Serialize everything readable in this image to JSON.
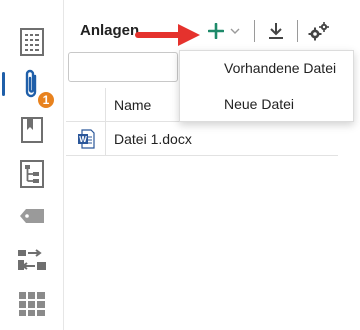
{
  "rail": {
    "items": [
      {
        "name": "document-grid-icon"
      },
      {
        "name": "paperclip-icon",
        "active": true,
        "badge": "1"
      },
      {
        "name": "bookmark-icon"
      },
      {
        "name": "hierarchy-icon"
      },
      {
        "name": "tag-icon"
      },
      {
        "name": "transfer-icon"
      },
      {
        "name": "tiles-icon"
      }
    ]
  },
  "panel": {
    "title": "Anlagen",
    "toolbar": {
      "add_icon": "plus-icon",
      "add_dropdown_icon": "chevron-down-icon",
      "download_icon": "download-icon",
      "settings_icon": "gears-icon"
    },
    "table": {
      "columns": [
        "Name"
      ],
      "rows": [
        {
          "icon": "word-document-icon",
          "name": "Datei 1.docx"
        }
      ]
    }
  },
  "dropdown": {
    "items": [
      "Vorhandene Datei",
      "Neue Datei"
    ]
  },
  "colors": {
    "accent_green": "#1e8a6a",
    "badge_orange": "#e8821e",
    "annotation_red": "#e5322d",
    "rail_icon_gray": "#6f6f6f",
    "active_blue": "#1f5fa9",
    "word_blue": "#2b579a"
  }
}
